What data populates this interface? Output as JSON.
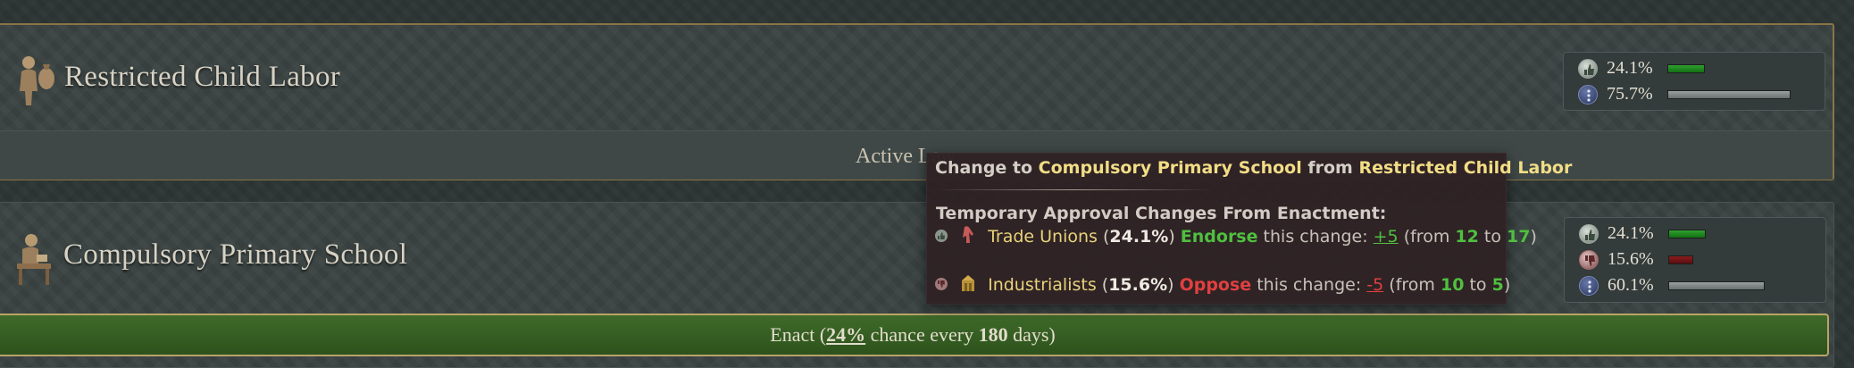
{
  "laws": [
    {
      "title": "Restricted Child Labor",
      "status": "Active Law",
      "approval": [
        {
          "icon": "approve-icon",
          "value": "24.1%",
          "fraction": 0.241,
          "color": "#1f8f1f"
        },
        {
          "icon": "neutral-icon",
          "value": "75.7%",
          "fraction": 0.757,
          "color": "#8a9090"
        }
      ]
    },
    {
      "title": "Compulsory Primary School",
      "approval": [
        {
          "icon": "approve-icon",
          "value": "24.1%",
          "fraction": 0.241,
          "color": "#1f8f1f"
        },
        {
          "icon": "disapprove-icon",
          "value": "15.6%",
          "fraction": 0.156,
          "color": "#7a1818"
        },
        {
          "icon": "neutral-icon",
          "value": "60.1%",
          "fraction": 0.601,
          "color": "#8a9090"
        }
      ]
    }
  ],
  "enact": {
    "prefix": "Enact (",
    "chance": "24%",
    "middle": " chance every ",
    "days": "180",
    "suffix": " days)"
  },
  "tooltip": {
    "head_prefix": "Change to ",
    "target_law": "Compulsory Primary School",
    "head_from": " from ",
    "current_law": "Restricted Child Labor",
    "subheading": "Temporary Approval Changes From Enactment:",
    "groups": [
      {
        "name": "Trade Unions",
        "pct": "24.1%",
        "stance": "Endorse",
        "change": "+5",
        "from": "12",
        "to": "17"
      },
      {
        "name": "Industrialists",
        "pct": "15.6%",
        "stance": "Oppose",
        "change": "-5",
        "from": "10",
        "to": "5"
      }
    ],
    "this_change_label": " this change: ",
    "from_label": "(from ",
    "to_label": " to ",
    "close_paren": ")"
  }
}
